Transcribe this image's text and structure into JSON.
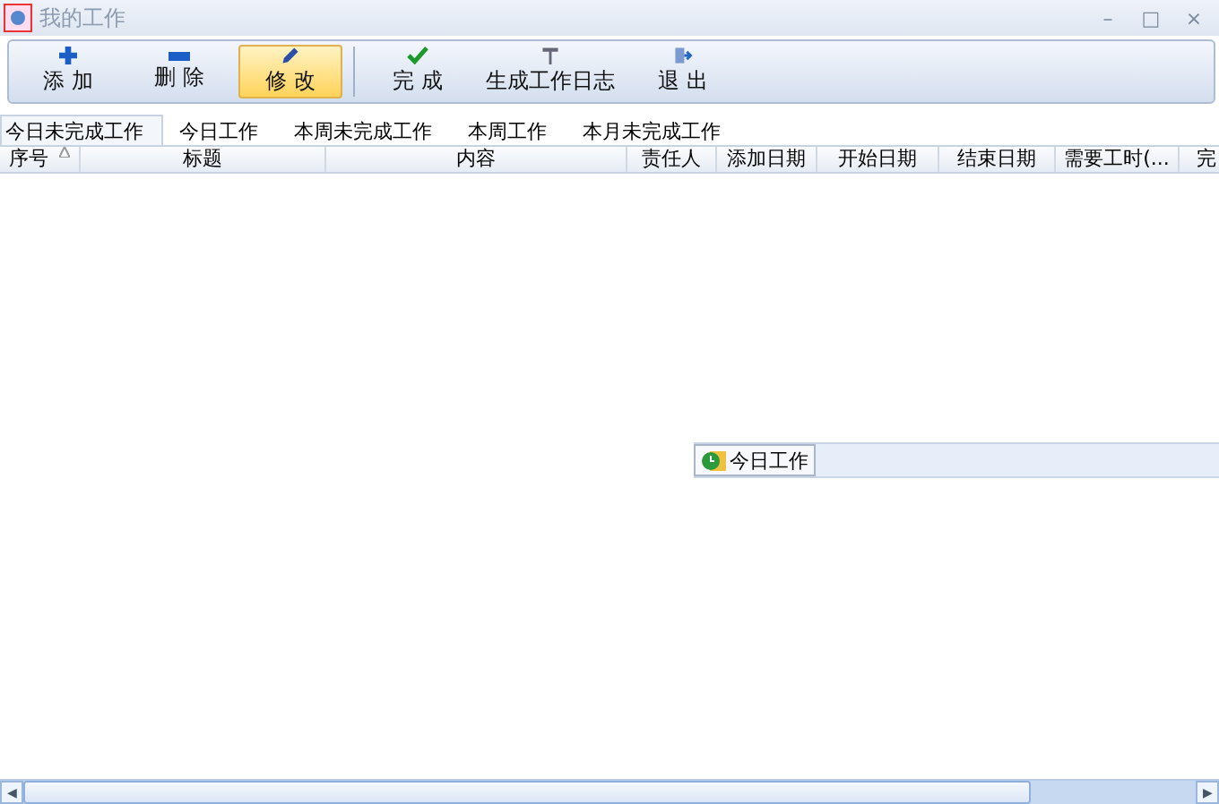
{
  "window": {
    "title": "我的工作",
    "controls": [
      "–",
      "□",
      "×"
    ]
  },
  "toolbar": [
    {
      "label": "添 加",
      "selected": false
    },
    {
      "label": "删 除",
      "selected": false
    },
    {
      "label": "修 改",
      "selected": true
    },
    {
      "label": "完 成",
      "selected": false
    },
    {
      "label": "生成工作日志",
      "selected": false
    },
    {
      "label": "退 出",
      "selected": false
    }
  ],
  "tabs": [
    {
      "label": "今日未完成工作",
      "selected": true
    },
    {
      "label": "今日工作",
      "selected": false
    },
    {
      "label": "本周未完成工作",
      "selected": false
    },
    {
      "label": "本周工作",
      "selected": false
    },
    {
      "label": "本月未完成工作",
      "selected": false
    }
  ],
  "table": {
    "columns": [
      {
        "label": "序号"
      },
      {
        "label": "标题"
      },
      {
        "label": "内容"
      },
      {
        "label": "责任人"
      },
      {
        "label": "添加日期"
      },
      {
        "label": "开始日期"
      },
      {
        "label": "结束日期"
      },
      {
        "label": "需要工时(..."
      },
      {
        "label": "完"
      }
    ]
  },
  "floating_panel": {
    "label": "今日工作"
  },
  "scrollbar": {
    "left": "◀",
    "right": "▶"
  }
}
